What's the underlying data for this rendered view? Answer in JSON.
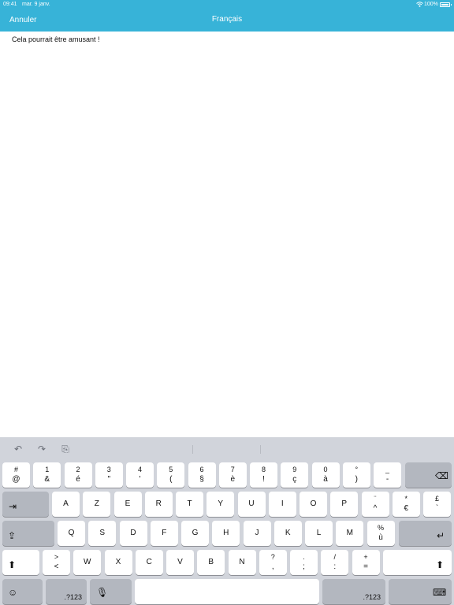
{
  "status_bar": {
    "time": "09:41",
    "date": "mar. 9 janv.",
    "battery": "100%"
  },
  "nav": {
    "cancel": "Annuler",
    "title": "Français"
  },
  "text": {
    "content": "Cela pourrait être amusant !"
  },
  "keyboard": {
    "shortcuts": [
      {
        "name": "undo-icon",
        "glyph": "↶"
      },
      {
        "name": "redo-icon",
        "glyph": "↷"
      },
      {
        "name": "paste-icon",
        "glyph": "⎘"
      }
    ],
    "row1": [
      {
        "top": "#",
        "bottom": "@"
      },
      {
        "top": "1",
        "bottom": "&"
      },
      {
        "top": "2",
        "bottom": "é"
      },
      {
        "top": "3",
        "bottom": "\""
      },
      {
        "top": "4",
        "bottom": "'"
      },
      {
        "top": "5",
        "bottom": "("
      },
      {
        "top": "6",
        "bottom": "§"
      },
      {
        "top": "7",
        "bottom": "è"
      },
      {
        "top": "8",
        "bottom": "!"
      },
      {
        "top": "9",
        "bottom": "ç"
      },
      {
        "top": "0",
        "bottom": "à"
      },
      {
        "top": "°",
        "bottom": ")"
      },
      {
        "top": "_",
        "bottom": "-"
      }
    ],
    "row2": [
      {
        "label": "A"
      },
      {
        "label": "Z"
      },
      {
        "label": "E"
      },
      {
        "label": "R"
      },
      {
        "label": "T"
      },
      {
        "label": "Y"
      },
      {
        "label": "U"
      },
      {
        "label": "I"
      },
      {
        "label": "O"
      },
      {
        "label": "P"
      },
      {
        "top": "¨",
        "bottom": "^"
      },
      {
        "top": "*",
        "bottom": "€"
      },
      {
        "top": "£",
        "bottom": "`"
      }
    ],
    "row3": [
      {
        "label": "Q"
      },
      {
        "label": "S"
      },
      {
        "label": "D"
      },
      {
        "label": "F"
      },
      {
        "label": "G"
      },
      {
        "label": "H"
      },
      {
        "label": "J"
      },
      {
        "label": "K"
      },
      {
        "label": "L"
      },
      {
        "label": "M"
      },
      {
        "top": "%",
        "bottom": "ù"
      }
    ],
    "row4": [
      {
        "top": ">",
        "bottom": "<"
      },
      {
        "label": "W"
      },
      {
        "label": "X"
      },
      {
        "label": "C"
      },
      {
        "label": "V"
      },
      {
        "label": "B"
      },
      {
        "label": "N"
      },
      {
        "top": "?",
        "bottom": ","
      },
      {
        "top": ".",
        "bottom": ";"
      },
      {
        "top": "/",
        "bottom": ":"
      },
      {
        "top": "+",
        "bottom": "="
      }
    ],
    "numbers_label": ".?123"
  }
}
